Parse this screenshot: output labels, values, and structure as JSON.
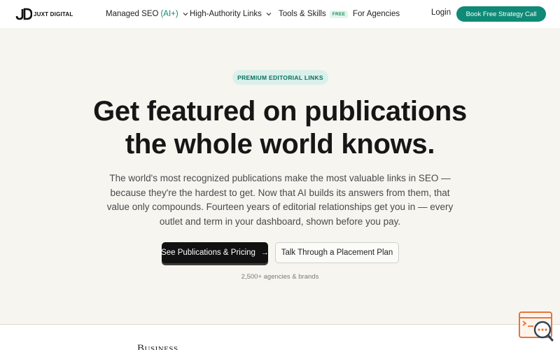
{
  "brand": {
    "name": "JUXT DIGITAL"
  },
  "nav": {
    "items": [
      {
        "label": "Managed SEO",
        "accent": "(AI+)",
        "has_dropdown": true
      },
      {
        "label": "High-Authority Links",
        "has_dropdown": true
      },
      {
        "label": "Tools & Skills",
        "badge": "FREE",
        "has_dropdown": false
      },
      {
        "label": "For Agencies",
        "has_dropdown": false
      }
    ],
    "login": "Login",
    "cta": "Book Free Strategy Call"
  },
  "hero": {
    "badge": "PREMIUM EDITORIAL LINKS",
    "headline": [
      "Get featured on publications",
      "the whole world knows."
    ],
    "subtext": [
      "The world's most recognized publications make the most valuable links in SEO —",
      "because they're the hardest to get. Now that AI builds its answers from them, that",
      "value only compounds. Fourteen years of editorial relationships get you in — every",
      "outlet and term in your dashboard, shown before you pay."
    ],
    "primary_button": "See Publications & Pricing",
    "primary_arrow": "→",
    "secondary_button": "Talk Through a Placement Plan",
    "social_proof": "2,500+ agencies & brands"
  },
  "section": {
    "label": "Business"
  },
  "colors": {
    "accent": "#0f8a77",
    "page_background": "#f6f5f0",
    "badge_background": "#d9f1ea",
    "primary_button": "#111111",
    "widget_orange": "#e8743b"
  },
  "icons": {
    "logo": "jd-logo-icon",
    "dropdown": "chevron-down-icon",
    "arrow": "arrow-right-icon",
    "widget": "chat-search-icon"
  }
}
